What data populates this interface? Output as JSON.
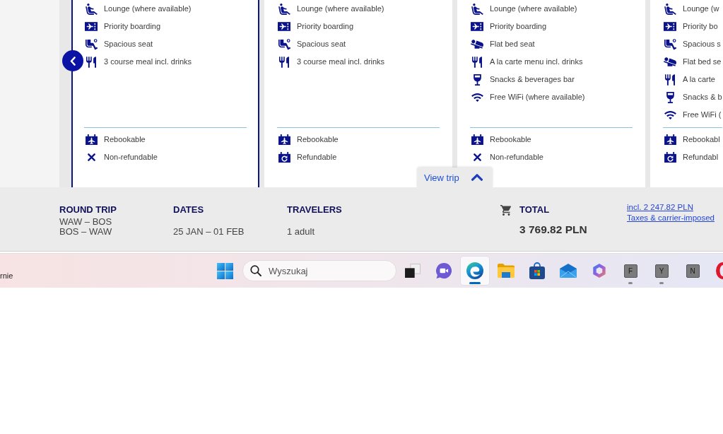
{
  "fare_cards": [
    {
      "selected": true,
      "features": [
        {
          "kind": "lounge",
          "label": "Lounge (where available)"
        },
        {
          "kind": "boarding",
          "label": "Priority boarding"
        },
        {
          "kind": "seat",
          "label": "Spacious seat"
        },
        {
          "kind": "meal",
          "label": "3 course meal incl. drinks"
        }
      ],
      "conditions": [
        {
          "kind": "rebook",
          "label": "Rebookable"
        },
        {
          "kind": "no_refund",
          "label": "Non-refundable"
        }
      ]
    },
    {
      "selected": false,
      "features": [
        {
          "kind": "lounge",
          "label": "Lounge (where available)"
        },
        {
          "kind": "boarding",
          "label": "Priority boarding"
        },
        {
          "kind": "seat",
          "label": "Spacious seat"
        },
        {
          "kind": "meal",
          "label": "3 course meal incl. drinks"
        }
      ],
      "conditions": [
        {
          "kind": "rebook",
          "label": "Rebookable"
        },
        {
          "kind": "refund",
          "label": "Refundable"
        }
      ]
    },
    {
      "selected": false,
      "features": [
        {
          "kind": "lounge",
          "label": "Lounge (where available)"
        },
        {
          "kind": "boarding",
          "label": "Priority boarding"
        },
        {
          "kind": "bed",
          "label": "Flat bed seat"
        },
        {
          "kind": "meal",
          "label": "A la carte menu incl. drinks"
        },
        {
          "kind": "bar",
          "label": "Snacks & beverages bar"
        },
        {
          "kind": "wifi",
          "label": "Free WiFi (where available)"
        }
      ],
      "conditions": [
        {
          "kind": "rebook",
          "label": "Rebookable"
        },
        {
          "kind": "no_refund",
          "label": "Non-refundable"
        }
      ]
    },
    {
      "selected": false,
      "features": [
        {
          "kind": "lounge",
          "label": "Lounge (w"
        },
        {
          "kind": "boarding",
          "label": "Priority bo"
        },
        {
          "kind": "seat",
          "label": "Spacious s"
        },
        {
          "kind": "bed",
          "label": "Flat bed se"
        },
        {
          "kind": "meal",
          "label": "A la carte"
        },
        {
          "kind": "bar",
          "label": "Snacks & b"
        },
        {
          "kind": "wifi",
          "label": "Free WiFi ("
        }
      ],
      "conditions": [
        {
          "kind": "rebook",
          "label": "Rebookabl"
        },
        {
          "kind": "refund",
          "label": "Refundabl"
        }
      ]
    }
  ],
  "view_trip": {
    "label": "View trip",
    "expanded": false
  },
  "summary": {
    "columns": [
      {
        "heading": "ROUND TRIP",
        "lines": [
          "WAW – BOS",
          "BOS – WAW"
        ]
      },
      {
        "heading": "DATES",
        "lines": [
          "25 JAN – 01 FEB"
        ]
      },
      {
        "heading": "TRAVELERS",
        "lines": [
          "1 adult"
        ]
      }
    ],
    "total": {
      "heading": "TOTAL",
      "amount": "3 769.82 PLN"
    },
    "links": [
      "incl. 2 247.82 PLN",
      "Taxes & carrier-imposed"
    ]
  },
  "taskbar": {
    "widget_text": "rnie",
    "search": {
      "placeholder": "Wyszukaj"
    },
    "apps": [
      {
        "kind": "task_view",
        "selected": false,
        "running": false
      },
      {
        "kind": "chat",
        "selected": false,
        "running": false
      },
      {
        "kind": "browser",
        "selected": true,
        "running": true
      },
      {
        "kind": "folder",
        "selected": false,
        "running": false
      },
      {
        "kind": "store",
        "selected": false,
        "running": false
      },
      {
        "kind": "mail",
        "selected": false,
        "running": false
      },
      {
        "kind": "copilot",
        "selected": false,
        "running": false
      },
      {
        "kind": "letter",
        "label": "F",
        "selected": false,
        "running": true
      },
      {
        "kind": "letter",
        "label": "Y",
        "selected": false,
        "running": true
      },
      {
        "kind": "letter",
        "label": "N",
        "selected": false,
        "running": false
      },
      {
        "kind": "ring",
        "selected": false,
        "running": false
      }
    ]
  }
}
